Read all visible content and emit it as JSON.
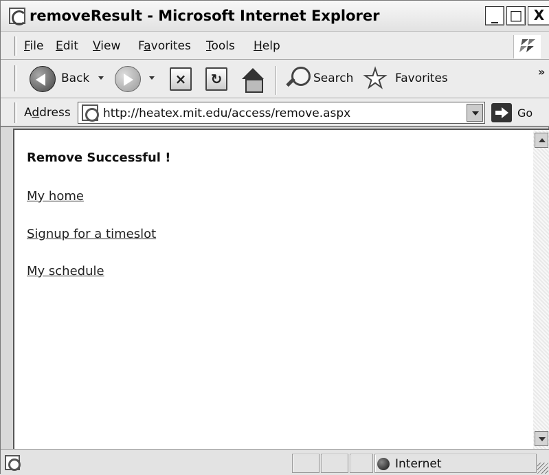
{
  "window": {
    "title": "removeResult - Microsoft Internet Explorer",
    "controls": {
      "minimize": "_",
      "maximize": "□",
      "close": "X"
    }
  },
  "menu": {
    "items": [
      {
        "underline": "F",
        "rest": "ile"
      },
      {
        "underline": "E",
        "rest": "dit"
      },
      {
        "underline": "V",
        "rest": "iew"
      },
      {
        "pre": "F",
        "underline": "a",
        "rest": "vorites"
      },
      {
        "underline": "T",
        "rest": "ools"
      },
      {
        "underline": "H",
        "rest": "elp"
      }
    ]
  },
  "toolbar": {
    "back_label": "Back",
    "search_label": "Search",
    "favorites_label": "Favorites",
    "more": "»",
    "stop_glyph": "×",
    "refresh_glyph": "↻"
  },
  "address": {
    "label_pre": "A",
    "label_u": "d",
    "label_rest": "dress",
    "url": "http://heatex.mit.edu/access/remove.aspx",
    "go_label": "Go"
  },
  "page": {
    "heading": "Remove Successful !",
    "links": [
      "My home",
      "Signup for a timeslot",
      "My schedule"
    ]
  },
  "status": {
    "zone": "Internet"
  },
  "icons": {
    "app": "ie-logo-icon",
    "back": "back-arrow-icon",
    "forward": "forward-arrow-icon",
    "stop": "stop-icon",
    "refresh": "refresh-icon",
    "home": "home-icon",
    "search": "search-icon",
    "favorites": "star-icon",
    "go": "go-arrow-icon",
    "zone": "internet-globe-icon"
  }
}
